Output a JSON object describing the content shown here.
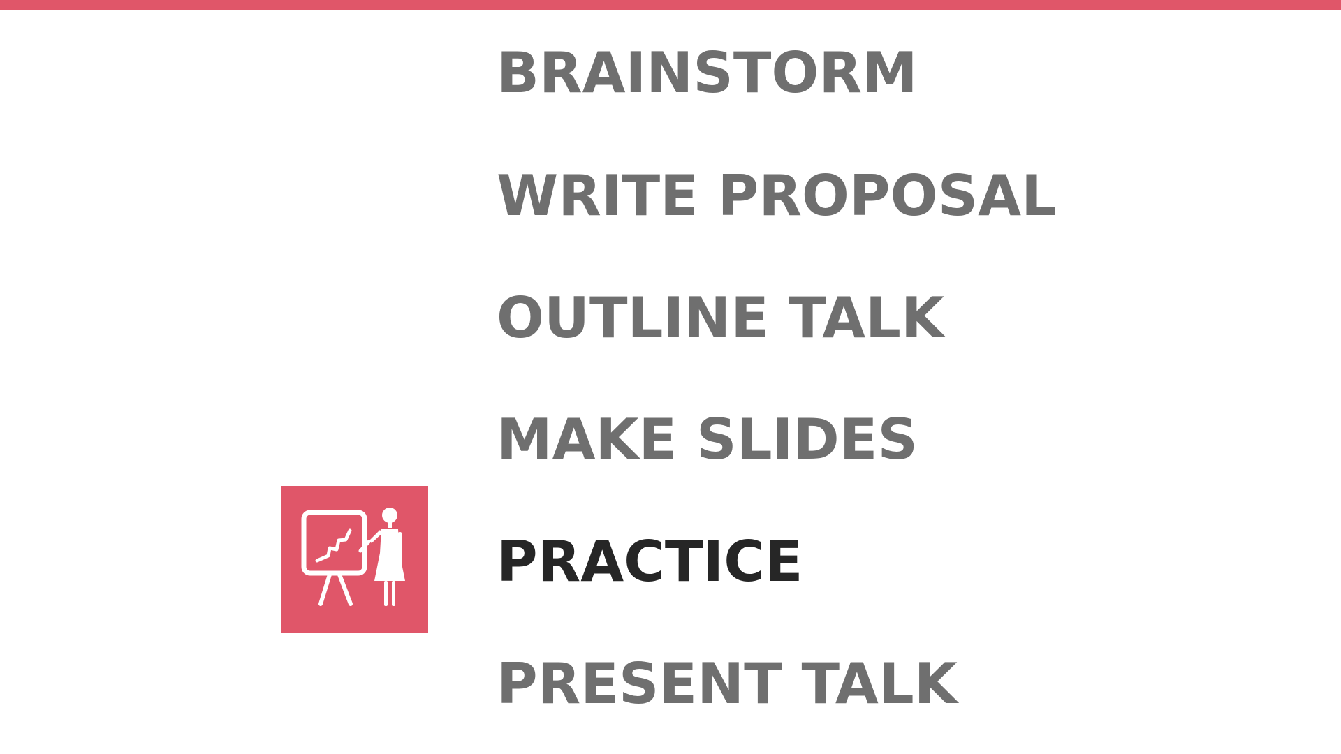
{
  "colors": {
    "accent": "#e05669",
    "step_text": "#6f6f6f",
    "active_step_text": "#262626",
    "background": "#ffffff",
    "icon_glyph": "#ffffff"
  },
  "steps": [
    {
      "label": "BRAINSTORM",
      "active": false
    },
    {
      "label": "WRITE PROPOSAL",
      "active": false
    },
    {
      "label": "OUTLINE TALK",
      "active": false
    },
    {
      "label": "MAKE SLIDES",
      "active": false
    },
    {
      "label": "PRACTICE",
      "active": true
    },
    {
      "label": "PRESENT TALK",
      "active": false
    }
  ],
  "active_step_icon": "presenter-at-easel-icon"
}
